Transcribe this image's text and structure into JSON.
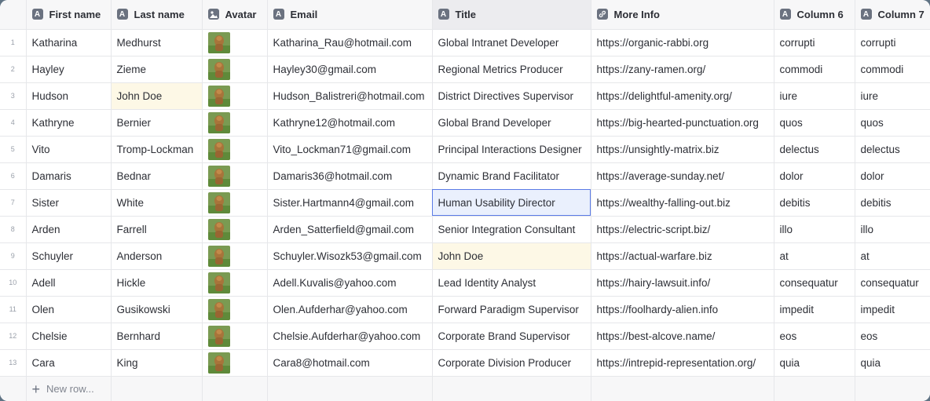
{
  "columns": [
    {
      "label": "First name",
      "icon": "text-type-icon"
    },
    {
      "label": "Last name",
      "icon": "text-type-icon"
    },
    {
      "label": "Avatar",
      "icon": "image-type-icon"
    },
    {
      "label": "Email",
      "icon": "text-type-icon"
    },
    {
      "label": "Title",
      "icon": "text-type-icon"
    },
    {
      "label": "More Info",
      "icon": "link-type-icon"
    },
    {
      "label": "Column 6",
      "icon": "text-type-icon"
    },
    {
      "label": "Column 7",
      "icon": "text-type-icon"
    }
  ],
  "type_icon_letter": "A",
  "rows": [
    {
      "num": "1",
      "first": "Katharina",
      "last": "Medhurst",
      "email": "Katharina_Rau@hotmail.com",
      "title": "Global Intranet Developer",
      "info": "https://organic-rabbi.org",
      "c6": "corrupti",
      "c7": "corrupti"
    },
    {
      "num": "2",
      "first": "Hayley",
      "last": "Zieme",
      "email": "Hayley30@gmail.com",
      "title": "Regional Metrics Producer",
      "info": "https://zany-ramen.org/",
      "c6": "commodi",
      "c7": "commodi"
    },
    {
      "num": "3",
      "first": "Hudson",
      "last": "John Doe",
      "email": "Hudson_Balistreri@hotmail.com",
      "title": "District Directives Supervisor",
      "info": "https://delightful-amenity.org/",
      "c6": "iure",
      "c7": "iure"
    },
    {
      "num": "4",
      "first": "Kathryne",
      "last": "Bernier",
      "email": "Kathryne12@hotmail.com",
      "title": "Global Brand Developer",
      "info": "https://big-hearted-punctuation.org",
      "c6": "quos",
      "c7": "quos"
    },
    {
      "num": "5",
      "first": "Vito",
      "last": "Tromp-Lockman",
      "email": "Vito_Lockman71@gmail.com",
      "title": "Principal Interactions Designer",
      "info": "https://unsightly-matrix.biz",
      "c6": "delectus",
      "c7": "delectus"
    },
    {
      "num": "6",
      "first": "Damaris",
      "last": "Bednar",
      "email": "Damaris36@hotmail.com",
      "title": "Dynamic Brand Facilitator",
      "info": "https://average-sunday.net/",
      "c6": "dolor",
      "c7": "dolor"
    },
    {
      "num": "7",
      "first": "Sister",
      "last": "White",
      "email": "Sister.Hartmann4@gmail.com",
      "title": "Human Usability Director",
      "info": "https://wealthy-falling-out.biz",
      "c6": "debitis",
      "c7": "debitis"
    },
    {
      "num": "8",
      "first": "Arden",
      "last": "Farrell",
      "email": "Arden_Satterfield@gmail.com",
      "title": "Senior Integration Consultant",
      "info": "https://electric-script.biz/",
      "c6": "illo",
      "c7": "illo"
    },
    {
      "num": "9",
      "first": "Schuyler",
      "last": "Anderson",
      "email": "Schuyler.Wisozk53@gmail.com",
      "title": "John Doe",
      "info": "https://actual-warfare.biz",
      "c6": "at",
      "c7": "at"
    },
    {
      "num": "10",
      "first": "Adell",
      "last": "Hickle",
      "email": "Adell.Kuvalis@yahoo.com",
      "title": "Lead Identity Analyst",
      "info": "https://hairy-lawsuit.info/",
      "c6": "consequatur",
      "c7": "consequatur"
    },
    {
      "num": "11",
      "first": "Olen",
      "last": "Gusikowski",
      "email": "Olen.Aufderhar@yahoo.com",
      "title": "Forward Paradigm Supervisor",
      "info": "https://foolhardy-alien.info",
      "c6": "impedit",
      "c7": "impedit"
    },
    {
      "num": "12",
      "first": "Chelsie",
      "last": "Bernhard",
      "email": "Chelsie.Aufderhar@yahoo.com",
      "title": "Corporate Brand Supervisor",
      "info": "https://best-alcove.name/",
      "c6": "eos",
      "c7": "eos"
    },
    {
      "num": "13",
      "first": "Cara",
      "last": "King",
      "email": "Cara8@hotmail.com",
      "title": "Corporate Division Producer",
      "info": "https://intrepid-representation.org/",
      "c6": "quia",
      "c7": "quia"
    }
  ],
  "new_row_label": "New row...",
  "colors": {
    "selected_cell_border": "#5b7be6",
    "highlight_cell_bg": "#fdf8e6",
    "header_bg": "#f7f7f8"
  }
}
